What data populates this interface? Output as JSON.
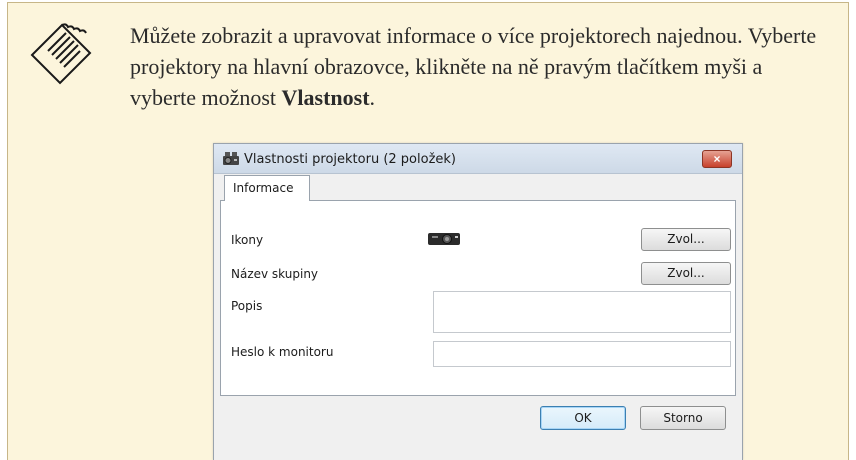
{
  "note": {
    "icon": "note-pad-icon",
    "text_plain": "Můžete zobrazit a upravovat informace o více projektorech najednou. Vyberte projektory na hlavní obrazovce, klikněte na ně pravým tlačítkem myši a vyberte možnost ",
    "text_bold": "Vlastnost",
    "text_end": "."
  },
  "dialog": {
    "title": "Vlastnosti projektoru (2 položek)",
    "close_label": "×",
    "tab_label": "Informace",
    "fields": {
      "icons_label": "Ikony",
      "icons_button": "Zvol...",
      "group_label": "Název skupiny",
      "group_button": "Zvol...",
      "description_label": "Popis",
      "description_value": "",
      "password_label": "Heslo k monitoru",
      "password_value": ""
    },
    "ok_label": "OK",
    "cancel_label": "Storno"
  }
}
